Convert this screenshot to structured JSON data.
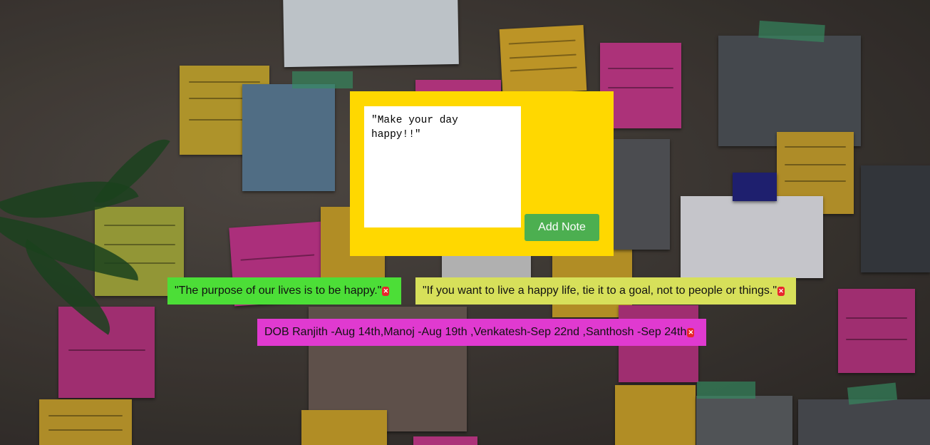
{
  "background": {
    "base_color": "#3a3632",
    "description_icon": "corkboard-icon"
  },
  "input_panel": {
    "color": "#ffd800",
    "textarea_value": "\"Make your day happy!!\"",
    "add_button_label": "Add Note",
    "add_button_color": "#4caf50"
  },
  "notes": [
    {
      "text": "\"The purpose of our lives is to be happy.\"",
      "color": "#4cde37",
      "delete_icon": "close-icon"
    },
    {
      "text": "\"If you want to live a happy life, tie it to a goal, not to people or things.\"",
      "color": "#d7e05a",
      "delete_icon": "close-icon"
    },
    {
      "text": "DOB Ranjith -Aug 14th,Manoj -Aug 19th ,Venkatesh-Sep 22nd ,Santhosh -Sep 24th",
      "color": "#e03ad0",
      "delete_icon": "close-icon"
    }
  ],
  "delete_symbol": "✕"
}
